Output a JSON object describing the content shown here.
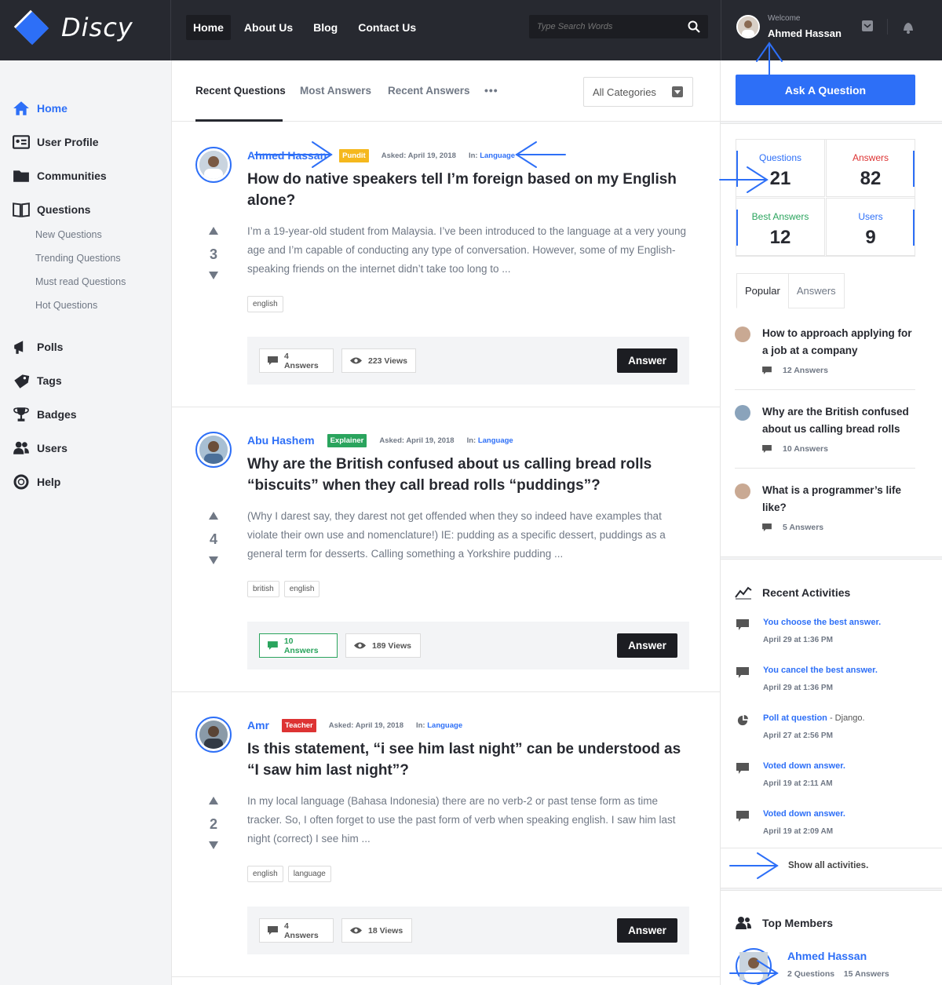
{
  "brand": {
    "name": "Discy",
    "colors": {
      "primary": "#2d6ff7",
      "dark": "#272930",
      "success": "#2aa45d",
      "pundit": "#f5b81d",
      "explainer": "#2aa45d",
      "teacher": "#dd3333"
    }
  },
  "header": {
    "nav": [
      "Home",
      "About Us",
      "Blog",
      "Contact Us"
    ],
    "search_placeholder": "Type Search Words",
    "welcome_label": "Welcome",
    "user_name": "Ahmed Hassan"
  },
  "sidebar": {
    "items": [
      {
        "label": "Home",
        "icon": "home-icon"
      },
      {
        "label": "User Profile",
        "icon": "profile-card-icon"
      },
      {
        "label": "Communities",
        "icon": "folder-icon"
      },
      {
        "label": "Questions",
        "icon": "book-icon"
      },
      {
        "label": "Polls",
        "icon": "megaphone-icon"
      },
      {
        "label": "Tags",
        "icon": "tag-icon"
      },
      {
        "label": "Badges",
        "icon": "trophy-icon"
      },
      {
        "label": "Users",
        "icon": "users-icon"
      },
      {
        "label": "Help",
        "icon": "lifebuoy-icon"
      }
    ],
    "sub_items": [
      "New Questions",
      "Trending Questions",
      "Must read Questions",
      "Hot Questions"
    ]
  },
  "main": {
    "tabs": [
      "Recent Questions",
      "Most Answers",
      "Recent Answers"
    ],
    "more": "•••",
    "category": "All Categories",
    "questions": [
      {
        "author": "Ahmed Hassan",
        "badge": "Pundit",
        "asked": "Asked: April 19, 2018",
        "in_label": "In:",
        "category": "Language",
        "title": "How do native speakers tell I’m foreign based on my English alone?",
        "votes": "3",
        "excerpt": "I’m a 19-year-old student from Malaysia. I’ve been introduced to the language at a very young age and I’m capable of conducting any type of conversation. However, some of my English-speaking friends on the internet didn’t take too long to ...",
        "tags": [
          "english"
        ],
        "answers": "4 Answers",
        "views": "223 Views",
        "answer_btn": "Answer"
      },
      {
        "author": "Abu Hashem",
        "badge": "Explainer",
        "asked": "Asked: April 19, 2018",
        "in_label": "In:",
        "category": "Language",
        "title": "Why are the British confused about us calling bread rolls “biscuits” when they call bread rolls “puddings”?",
        "votes": "4",
        "excerpt": "(Why I darest say, they darest not get offended when they so indeed have examples that violate their own use and nomenclature!) IE: pudding as a specific dessert, puddings as a general term for desserts. Calling something a Yorkshire pudding ...",
        "tags": [
          "british",
          "english"
        ],
        "answers": "10 Answers",
        "views": "189 Views",
        "answer_btn": "Answer"
      },
      {
        "author": "Amr",
        "badge": "Teacher",
        "asked": "Asked: April 19, 2018",
        "in_label": "In:",
        "category": "Language",
        "title": "Is this statement, “i see him last night” can be understood as “I saw him last night”?",
        "votes": "2",
        "excerpt": "In my local language (Bahasa Indonesia) there are no verb-2 or past tense form as time tracker. So, I often forget to use the past form of verb when speaking english. I saw him last night (correct) I see him ...",
        "tags": [
          "english",
          "language"
        ],
        "answers": "4 Answers",
        "views": "18 Views",
        "answer_btn": "Answer"
      }
    ]
  },
  "right": {
    "ask_button": "Ask A Question",
    "stats": [
      {
        "label": "Questions",
        "value": "21"
      },
      {
        "label": "Answers",
        "value": "82"
      },
      {
        "label": "Best Answers",
        "value": "12"
      },
      {
        "label": "Users",
        "value": "9"
      }
    ],
    "tabs": [
      "Popular",
      "Answers"
    ],
    "popular": [
      {
        "title": "How to approach applying for a job at a company",
        "answers": "12 Answers"
      },
      {
        "title": "Why are the British confused about us calling bread rolls",
        "answers": "10 Answers"
      },
      {
        "title": "What is a programmer’s life like?",
        "answers": "5 Answers"
      }
    ],
    "recent_title": "Recent Activities",
    "activities": [
      {
        "text": "You choose the best answer.",
        "extra": "",
        "date": "April 29 at 1:36 PM"
      },
      {
        "text": "You cancel the best answer.",
        "extra": "",
        "date": "April 29 at 1:36 PM"
      },
      {
        "text": "Poll at question",
        "extra": " - Django.",
        "date": "April 27 at 2:56 PM"
      },
      {
        "text": "Voted down answer.",
        "extra": "",
        "date": "April 19 at 2:11 AM"
      },
      {
        "text": "Voted down answer.",
        "extra": "",
        "date": "April 19 at 2:09 AM"
      }
    ],
    "show_all": "Show all activities.",
    "top_members_title": "Top Members",
    "member": {
      "name": "Ahmed Hassan",
      "questions": "2 Questions",
      "answers": "15 Answers"
    }
  }
}
